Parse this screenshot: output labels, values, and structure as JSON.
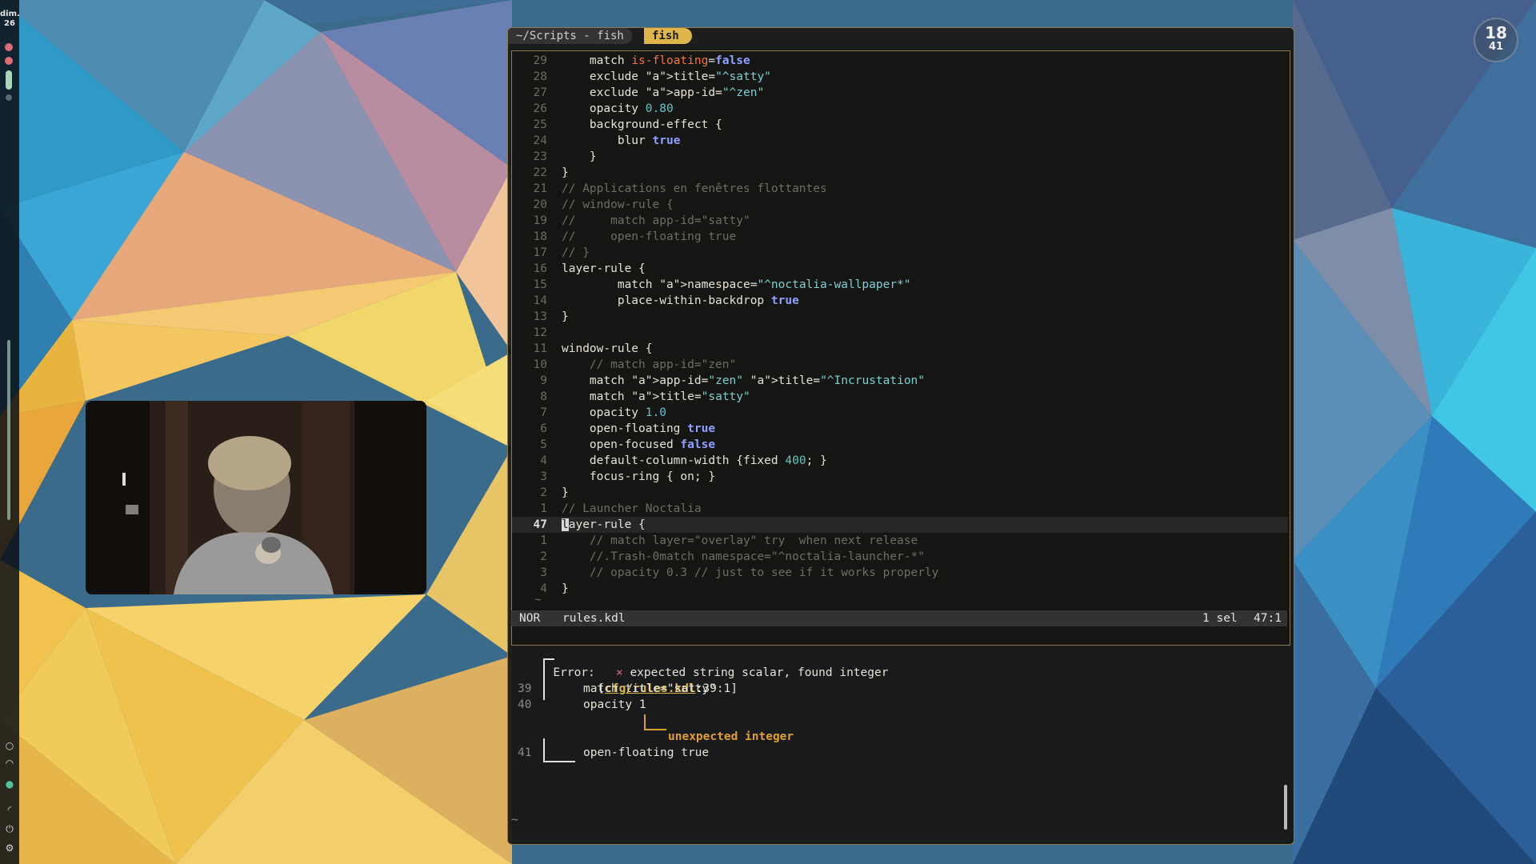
{
  "sidebar": {
    "date_day": "dim.",
    "date_num": "26"
  },
  "clock": {
    "hour": "18",
    "minute": "41"
  },
  "terminal": {
    "tab_path": "~/Scripts - fish",
    "tab_active": "fish",
    "status": {
      "mode": "NOR",
      "filename": "rules.kdl",
      "selection": "1 sel",
      "position": "47:1"
    },
    "lines": [
      {
        "num": "29",
        "code": "    match is-floating=false"
      },
      {
        "num": "28",
        "code": "    exclude title=\"^satty\""
      },
      {
        "num": "27",
        "code": "    exclude app-id=\"^zen\""
      },
      {
        "num": "26",
        "code": "    opacity 0.80"
      },
      {
        "num": "25",
        "code": "    background-effect {"
      },
      {
        "num": "24",
        "code": "        blur true"
      },
      {
        "num": "23",
        "code": "    }"
      },
      {
        "num": "22",
        "code": "}"
      },
      {
        "num": "21",
        "code": "// Applications en fenêtres flottantes"
      },
      {
        "num": "20",
        "code": "// window-rule {"
      },
      {
        "num": "19",
        "code": "//     match app-id=\"satty\""
      },
      {
        "num": "18",
        "code": "//     open-floating true"
      },
      {
        "num": "17",
        "code": "// }"
      },
      {
        "num": "16",
        "code": "layer-rule {"
      },
      {
        "num": "15",
        "code": "        match namespace=\"^noctalia-wallpaper*\""
      },
      {
        "num": "14",
        "code": "        place-within-backdrop true"
      },
      {
        "num": "13",
        "code": "}"
      },
      {
        "num": "12",
        "code": ""
      },
      {
        "num": "11",
        "code": "window-rule {"
      },
      {
        "num": "10",
        "code": "    // match app-id=\"zen\""
      },
      {
        "num": "9",
        "code": "    match app-id=\"zen\" title=\"^Incrustation\""
      },
      {
        "num": "8",
        "code": "    match title=\"satty\""
      },
      {
        "num": "7",
        "code": "    opacity 1.0"
      },
      {
        "num": "6",
        "code": "    open-floating true"
      },
      {
        "num": "5",
        "code": "    open-focused false"
      },
      {
        "num": "4",
        "code": "    default-column-width {fixed 400; }"
      },
      {
        "num": "3",
        "code": "    focus-ring { on; }"
      },
      {
        "num": "2",
        "code": "}"
      },
      {
        "num": "1",
        "code": "// Launcher Noctalia"
      },
      {
        "num": "47",
        "code": "layer-rule {"
      },
      {
        "num": "1",
        "code": "    // match layer=\"overlay\" try  when next release"
      },
      {
        "num": "2",
        "code": "    //.Trash-0match namespace=\"^noctalia-launcher-*\""
      },
      {
        "num": "3",
        "code": "    // opacity 0.3 // just to see if it works properly"
      },
      {
        "num": "4",
        "code": "}"
      }
    ],
    "tilde": "~",
    "error": {
      "label": "Error:",
      "cross": "×",
      "message": "expected string scalar, found integer",
      "location_file": "cfg/rules.kdl",
      "location_pos": ":39:1]",
      "location_open": "[",
      "line39_num": "39",
      "line39_code": "match title=\"satty\"",
      "line40_num": "40",
      "line40_code": "opacity 1",
      "annotation": "unexpected integer",
      "line41_num": "41",
      "line41_code": "open-floating true",
      "prompt": "~"
    }
  },
  "colors": {
    "accent": "#e0b64a",
    "keyword_attr": "#f0763c",
    "string": "#7ed0d0",
    "boolean": "#8fa0ff",
    "comment": "#6f6c64"
  }
}
